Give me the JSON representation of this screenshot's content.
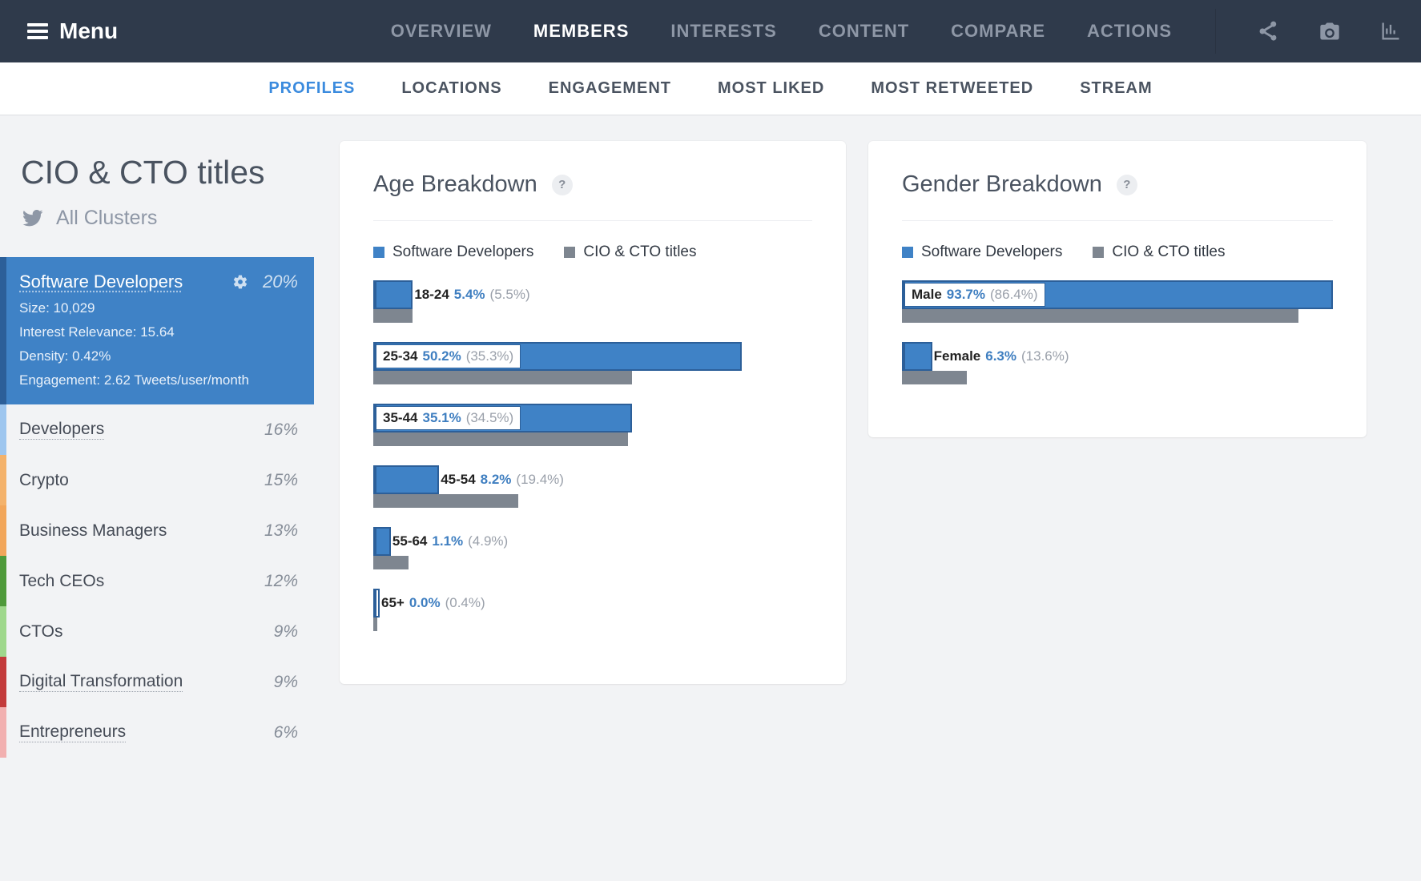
{
  "topnav": {
    "menu_label": "Menu",
    "links": [
      {
        "label": "OVERVIEW",
        "active": false
      },
      {
        "label": "MEMBERS",
        "active": true
      },
      {
        "label": "INTERESTS",
        "active": false
      },
      {
        "label": "CONTENT",
        "active": false
      },
      {
        "label": "COMPARE",
        "active": false
      },
      {
        "label": "ACTIONS",
        "active": false
      }
    ]
  },
  "subnav": {
    "links": [
      {
        "label": "PROFILES",
        "active": true
      },
      {
        "label": "LOCATIONS",
        "active": false
      },
      {
        "label": "ENGAGEMENT",
        "active": false
      },
      {
        "label": "MOST LIKED",
        "active": false
      },
      {
        "label": "MOST RETWEETED",
        "active": false
      },
      {
        "label": "STREAM",
        "active": false
      }
    ]
  },
  "sidebar": {
    "title": "CIO & CTO titles",
    "all_clusters_label": "All Clusters",
    "active": {
      "name": "Software Developers",
      "pct": "20%",
      "stats": {
        "size_label": "Size: 10,029",
        "relevance_label": "Interest Relevance: 15.64",
        "density_label": "Density: 0.42%",
        "engagement_label": "Engagement: 2.62 Tweets/user/month"
      }
    },
    "clusters": [
      {
        "name": "Developers",
        "pct": "16%",
        "color": "#9ec6ef",
        "underline": true
      },
      {
        "name": "Crypto",
        "pct": "15%",
        "color": "#f4b26b",
        "underline": false
      },
      {
        "name": "Business Managers",
        "pct": "13%",
        "color": "#f2a65a",
        "underline": false
      },
      {
        "name": "Tech CEOs",
        "pct": "12%",
        "color": "#4f9a3a",
        "underline": false
      },
      {
        "name": "CTOs",
        "pct": "9%",
        "color": "#9fd88c",
        "underline": false
      },
      {
        "name": "Digital Transformation",
        "pct": "9%",
        "color": "#c33b3b",
        "underline": true
      },
      {
        "name": "Entrepreneurs",
        "pct": "6%",
        "color": "#f2b0b0",
        "underline": true
      }
    ]
  },
  "cards": {
    "age": {
      "title": "Age Breakdown",
      "legend_primary": "Software Developers",
      "legend_secondary": "CIO & CTO titles"
    },
    "gender": {
      "title": "Gender Breakdown",
      "legend_primary": "Software Developers",
      "legend_secondary": "CIO & CTO titles"
    }
  },
  "chart_data": [
    {
      "type": "bar",
      "title": "Age Breakdown",
      "categories": [
        "18-24",
        "25-34",
        "35-44",
        "45-54",
        "55-64",
        "65+"
      ],
      "series": [
        {
          "name": "Software Developers",
          "values": [
            5.4,
            50.2,
            35.1,
            8.2,
            1.1,
            0.0
          ]
        },
        {
          "name": "CIO & CTO titles",
          "values": [
            5.5,
            35.3,
            34.5,
            19.4,
            4.9,
            0.4
          ]
        }
      ],
      "display": {
        "percent_width_primary": [
          9,
          84,
          59,
          15,
          4,
          0
        ],
        "percent_width_secondary": [
          9,
          59,
          58,
          33,
          8,
          1
        ],
        "label_inside": [
          false,
          true,
          true,
          false,
          false,
          false
        ]
      }
    },
    {
      "type": "bar",
      "title": "Gender Breakdown",
      "categories": [
        "Male",
        "Female"
      ],
      "series": [
        {
          "name": "Software Developers",
          "values": [
            93.7,
            6.3
          ]
        },
        {
          "name": "CIO & CTO titles",
          "values": [
            86.4,
            13.6
          ]
        }
      ],
      "display": {
        "percent_width_primary": [
          100,
          7
        ],
        "percent_width_secondary": [
          92,
          15
        ],
        "label_inside": [
          true,
          false
        ]
      }
    }
  ]
}
